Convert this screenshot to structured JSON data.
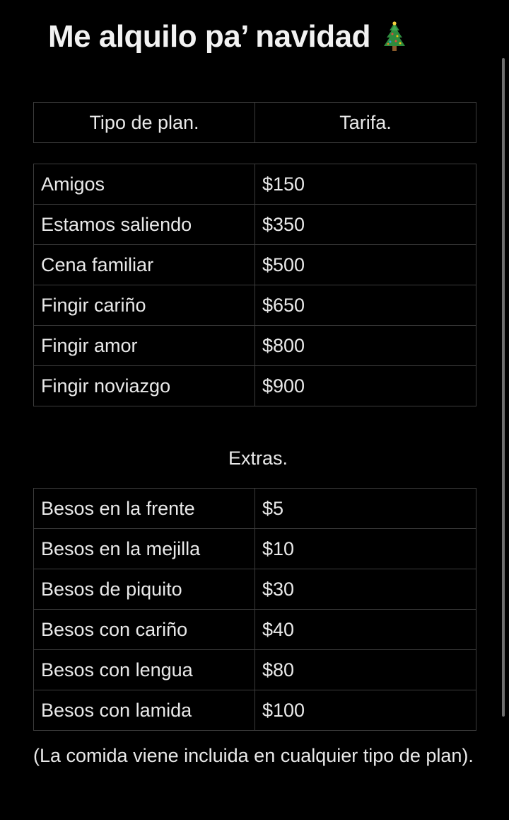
{
  "title": {
    "text": "Me alquilo pa’ navidad",
    "icon": "christmas-tree-icon"
  },
  "header_table": {
    "col1": "Tipo de plan.",
    "col2": "Tarifa."
  },
  "plans": [
    {
      "name": "Amigos",
      "price": "$150"
    },
    {
      "name": "Estamos saliendo",
      "price": "$350"
    },
    {
      "name": "Cena familiar",
      "price": "$500"
    },
    {
      "name": "Fingir cariño",
      "price": "$650"
    },
    {
      "name": "Fingir amor",
      "price": "$800"
    },
    {
      "name": "Fingir noviazgo",
      "price": "$900"
    }
  ],
  "extras_label": "Extras.",
  "extras": [
    {
      "name": "Besos en la frente",
      "price": "$5"
    },
    {
      "name": "Besos en la mejilla",
      "price": "$10"
    },
    {
      "name": "Besos de piquito",
      "price": "$30"
    },
    {
      "name": "Besos con cariño",
      "price": "$40"
    },
    {
      "name": "Besos con lengua",
      "price": "$80"
    },
    {
      "name": "Besos con lamida",
      "price": "$100"
    }
  ],
  "footnote": "(La comida viene incluida en cualquier tipo de plan).",
  "colors": {
    "background": "#000000",
    "text": "#e9e9e9",
    "border": "#3c3c3c"
  }
}
